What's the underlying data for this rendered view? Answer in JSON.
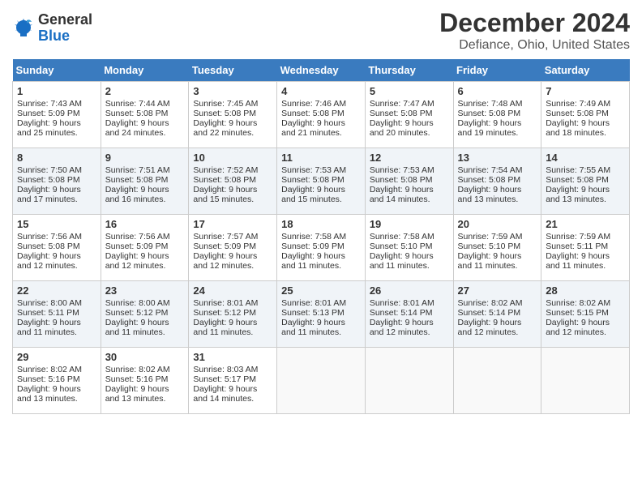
{
  "header": {
    "logo_general": "General",
    "logo_blue": "Blue",
    "month_year": "December 2024",
    "location": "Defiance, Ohio, United States"
  },
  "days_of_week": [
    "Sunday",
    "Monday",
    "Tuesday",
    "Wednesday",
    "Thursday",
    "Friday",
    "Saturday"
  ],
  "weeks": [
    [
      {
        "day": "1",
        "sunrise": "Sunrise: 7:43 AM",
        "sunset": "Sunset: 5:09 PM",
        "daylight": "Daylight: 9 hours and 25 minutes."
      },
      {
        "day": "2",
        "sunrise": "Sunrise: 7:44 AM",
        "sunset": "Sunset: 5:08 PM",
        "daylight": "Daylight: 9 hours and 24 minutes."
      },
      {
        "day": "3",
        "sunrise": "Sunrise: 7:45 AM",
        "sunset": "Sunset: 5:08 PM",
        "daylight": "Daylight: 9 hours and 22 minutes."
      },
      {
        "day": "4",
        "sunrise": "Sunrise: 7:46 AM",
        "sunset": "Sunset: 5:08 PM",
        "daylight": "Daylight: 9 hours and 21 minutes."
      },
      {
        "day": "5",
        "sunrise": "Sunrise: 7:47 AM",
        "sunset": "Sunset: 5:08 PM",
        "daylight": "Daylight: 9 hours and 20 minutes."
      },
      {
        "day": "6",
        "sunrise": "Sunrise: 7:48 AM",
        "sunset": "Sunset: 5:08 PM",
        "daylight": "Daylight: 9 hours and 19 minutes."
      },
      {
        "day": "7",
        "sunrise": "Sunrise: 7:49 AM",
        "sunset": "Sunset: 5:08 PM",
        "daylight": "Daylight: 9 hours and 18 minutes."
      }
    ],
    [
      {
        "day": "8",
        "sunrise": "Sunrise: 7:50 AM",
        "sunset": "Sunset: 5:08 PM",
        "daylight": "Daylight: 9 hours and 17 minutes."
      },
      {
        "day": "9",
        "sunrise": "Sunrise: 7:51 AM",
        "sunset": "Sunset: 5:08 PM",
        "daylight": "Daylight: 9 hours and 16 minutes."
      },
      {
        "day": "10",
        "sunrise": "Sunrise: 7:52 AM",
        "sunset": "Sunset: 5:08 PM",
        "daylight": "Daylight: 9 hours and 15 minutes."
      },
      {
        "day": "11",
        "sunrise": "Sunrise: 7:53 AM",
        "sunset": "Sunset: 5:08 PM",
        "daylight": "Daylight: 9 hours and 15 minutes."
      },
      {
        "day": "12",
        "sunrise": "Sunrise: 7:53 AM",
        "sunset": "Sunset: 5:08 PM",
        "daylight": "Daylight: 9 hours and 14 minutes."
      },
      {
        "day": "13",
        "sunrise": "Sunrise: 7:54 AM",
        "sunset": "Sunset: 5:08 PM",
        "daylight": "Daylight: 9 hours and 13 minutes."
      },
      {
        "day": "14",
        "sunrise": "Sunrise: 7:55 AM",
        "sunset": "Sunset: 5:08 PM",
        "daylight": "Daylight: 9 hours and 13 minutes."
      }
    ],
    [
      {
        "day": "15",
        "sunrise": "Sunrise: 7:56 AM",
        "sunset": "Sunset: 5:08 PM",
        "daylight": "Daylight: 9 hours and 12 minutes."
      },
      {
        "day": "16",
        "sunrise": "Sunrise: 7:56 AM",
        "sunset": "Sunset: 5:09 PM",
        "daylight": "Daylight: 9 hours and 12 minutes."
      },
      {
        "day": "17",
        "sunrise": "Sunrise: 7:57 AM",
        "sunset": "Sunset: 5:09 PM",
        "daylight": "Daylight: 9 hours and 12 minutes."
      },
      {
        "day": "18",
        "sunrise": "Sunrise: 7:58 AM",
        "sunset": "Sunset: 5:09 PM",
        "daylight": "Daylight: 9 hours and 11 minutes."
      },
      {
        "day": "19",
        "sunrise": "Sunrise: 7:58 AM",
        "sunset": "Sunset: 5:10 PM",
        "daylight": "Daylight: 9 hours and 11 minutes."
      },
      {
        "day": "20",
        "sunrise": "Sunrise: 7:59 AM",
        "sunset": "Sunset: 5:10 PM",
        "daylight": "Daylight: 9 hours and 11 minutes."
      },
      {
        "day": "21",
        "sunrise": "Sunrise: 7:59 AM",
        "sunset": "Sunset: 5:11 PM",
        "daylight": "Daylight: 9 hours and 11 minutes."
      }
    ],
    [
      {
        "day": "22",
        "sunrise": "Sunrise: 8:00 AM",
        "sunset": "Sunset: 5:11 PM",
        "daylight": "Daylight: 9 hours and 11 minutes."
      },
      {
        "day": "23",
        "sunrise": "Sunrise: 8:00 AM",
        "sunset": "Sunset: 5:12 PM",
        "daylight": "Daylight: 9 hours and 11 minutes."
      },
      {
        "day": "24",
        "sunrise": "Sunrise: 8:01 AM",
        "sunset": "Sunset: 5:12 PM",
        "daylight": "Daylight: 9 hours and 11 minutes."
      },
      {
        "day": "25",
        "sunrise": "Sunrise: 8:01 AM",
        "sunset": "Sunset: 5:13 PM",
        "daylight": "Daylight: 9 hours and 11 minutes."
      },
      {
        "day": "26",
        "sunrise": "Sunrise: 8:01 AM",
        "sunset": "Sunset: 5:14 PM",
        "daylight": "Daylight: 9 hours and 12 minutes."
      },
      {
        "day": "27",
        "sunrise": "Sunrise: 8:02 AM",
        "sunset": "Sunset: 5:14 PM",
        "daylight": "Daylight: 9 hours and 12 minutes."
      },
      {
        "day": "28",
        "sunrise": "Sunrise: 8:02 AM",
        "sunset": "Sunset: 5:15 PM",
        "daylight": "Daylight: 9 hours and 12 minutes."
      }
    ],
    [
      {
        "day": "29",
        "sunrise": "Sunrise: 8:02 AM",
        "sunset": "Sunset: 5:16 PM",
        "daylight": "Daylight: 9 hours and 13 minutes."
      },
      {
        "day": "30",
        "sunrise": "Sunrise: 8:02 AM",
        "sunset": "Sunset: 5:16 PM",
        "daylight": "Daylight: 9 hours and 13 minutes."
      },
      {
        "day": "31",
        "sunrise": "Sunrise: 8:03 AM",
        "sunset": "Sunset: 5:17 PM",
        "daylight": "Daylight: 9 hours and 14 minutes."
      },
      null,
      null,
      null,
      null
    ]
  ]
}
